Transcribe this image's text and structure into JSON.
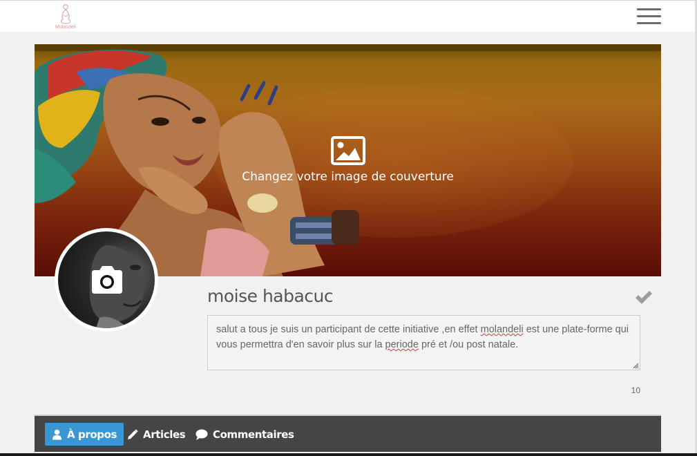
{
  "header": {
    "logo_text": "Molandeli",
    "menu_icon": "hamburger-menu-icon"
  },
  "cover": {
    "change_text": "Changez votre image de couverture",
    "icon": "image-icon"
  },
  "profile": {
    "name": "moise habacuc",
    "avatar_icon": "camera-icon",
    "verified_icon": "check-icon"
  },
  "bio": {
    "part1": "salut a tous je suis un participant de cette initiative ,en effet ",
    "word1": "molandeli",
    "part2": " est une plate-forme qui vous permettra d'en savoir plus sur la ",
    "word2": "periode",
    "part3": " pré et /ou post natale.",
    "counter": "10"
  },
  "tabs": [
    {
      "label": "À propos",
      "icon": "user-icon",
      "active": true
    },
    {
      "label": "Articles",
      "icon": "pencil-icon",
      "active": false
    },
    {
      "label": "Commentaires",
      "icon": "comment-icon",
      "active": false
    }
  ],
  "colors": {
    "accent": "#3a97d3",
    "tabbar": "#454545",
    "background": "#f1f1f1"
  }
}
